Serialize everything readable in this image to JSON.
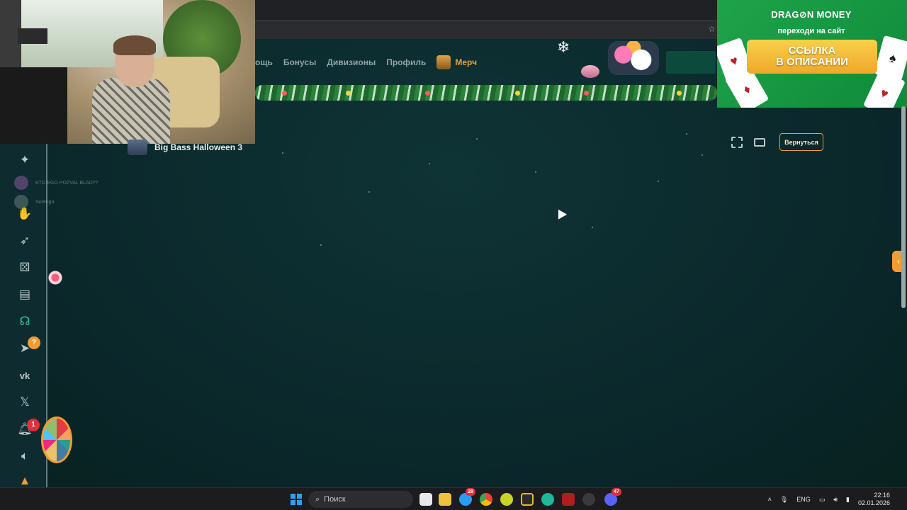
{
  "browser": {
    "star_icon": "star-icon"
  },
  "nav": {
    "items": [
      {
        "label": "ощь"
      },
      {
        "label": "Бонусы"
      },
      {
        "label": "Дивизионы"
      },
      {
        "label": "Профиль"
      }
    ],
    "merch_label": "Мерч"
  },
  "promo": {
    "brand": "DRAG⊘N MONEY",
    "subtitle": "переходи на сайт",
    "cta_line1": "ССЫЛКА",
    "cta_line2": "В ОПИСАНИИ"
  },
  "chat": {
    "lines": [
      {
        "text": "KTO EGO POZVAL BLAD??"
      },
      {
        "text": "Sorenga"
      }
    ]
  },
  "game": {
    "title": "Big Bass Halloween 3"
  },
  "controls": {
    "back_label": "Вернуться"
  },
  "sidebar": {
    "badges": {
      "telegram": "?",
      "notifications": "1"
    }
  },
  "taskbar": {
    "search_placeholder": "Поиск",
    "language": "ENG",
    "time": "22:16",
    "date": "02.01.2026",
    "chrome_badge": "28",
    "discord_badge": "47"
  },
  "colors": {
    "accent_orange": "#f29c33",
    "page_bg": "#0b2a2e",
    "active_green": "#2fd1a4",
    "promo_green": "#1fa34a"
  }
}
